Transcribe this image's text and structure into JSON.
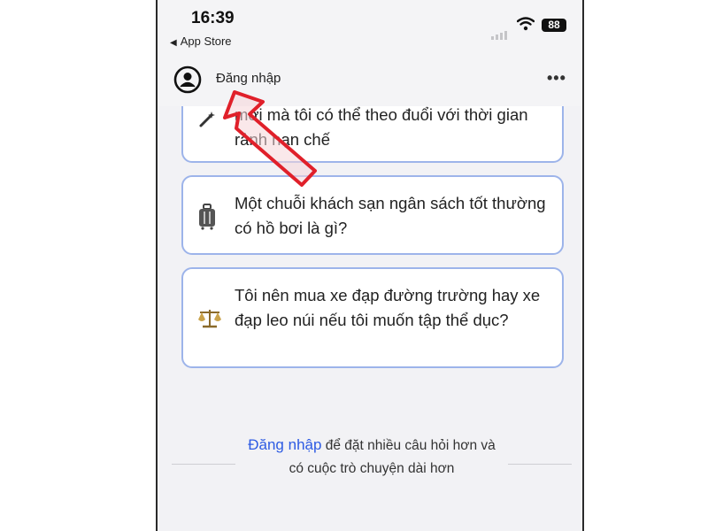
{
  "status_bar": {
    "time": "16:39",
    "back_label": "App Store",
    "battery": "88"
  },
  "header": {
    "title": "Đăng nhập",
    "more": "•••"
  },
  "cards": [
    {
      "icon": "magic-wand-icon",
      "text": "mới mà tôi có thể theo đuổi với thời gian rảnh hạn chế"
    },
    {
      "icon": "luggage-icon",
      "text": "Một chuỗi khách sạn ngân sách tốt thường có hồ bơi là gì?"
    },
    {
      "icon": "balance-scale-icon",
      "text": "Tôi nên mua xe đạp đường trường hay xe đạp leo núi nếu tôi muốn tập thể dục?"
    }
  ],
  "footer": {
    "link": "Đăng nhập",
    "text": " để đặt nhiều câu hỏi hơn và có cuộc trò chuyện dài hơn"
  },
  "colors": {
    "accent": "#2d5be3",
    "card_border": "#9db4ea",
    "annotation_arrow": "#e0202a"
  }
}
